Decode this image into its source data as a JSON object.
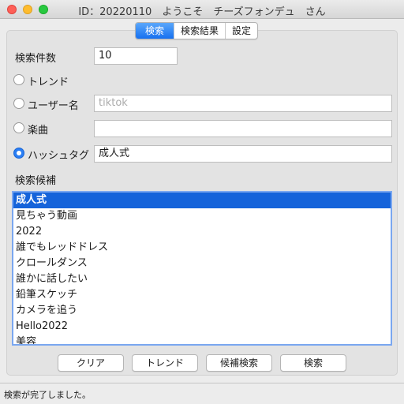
{
  "window": {
    "title": "ID：20220110　ようこそ　チーズフォンデュ　さん"
  },
  "tabs": [
    {
      "label": "検索"
    },
    {
      "label": "検索結果"
    },
    {
      "label": "設定"
    }
  ],
  "form": {
    "count_label": "検索件数",
    "count_value": "10",
    "trend_label": "トレンド",
    "username_label": "ユーザー名",
    "username_placeholder": "tiktok",
    "music_label": "楽曲",
    "music_value": "",
    "hashtag_label": "ハッシュタグ",
    "hashtag_value": "成人式",
    "selected_option": "hashtag",
    "candidates_label": "検索候補"
  },
  "candidates": [
    "成人式",
    "見ちゃう動画",
    "2022",
    "誰でもレッドドレス",
    "クロールダンス",
    "誰かに話したい",
    "鉛筆スケッチ",
    "カメラを追う",
    "Hello2022",
    "美容"
  ],
  "buttons": {
    "clear": "クリア",
    "trend": "トレンド",
    "candidate_search": "候補検索",
    "search": "検索"
  },
  "status": "検索が完了しました。",
  "colors": {
    "accent": "#1563da"
  }
}
